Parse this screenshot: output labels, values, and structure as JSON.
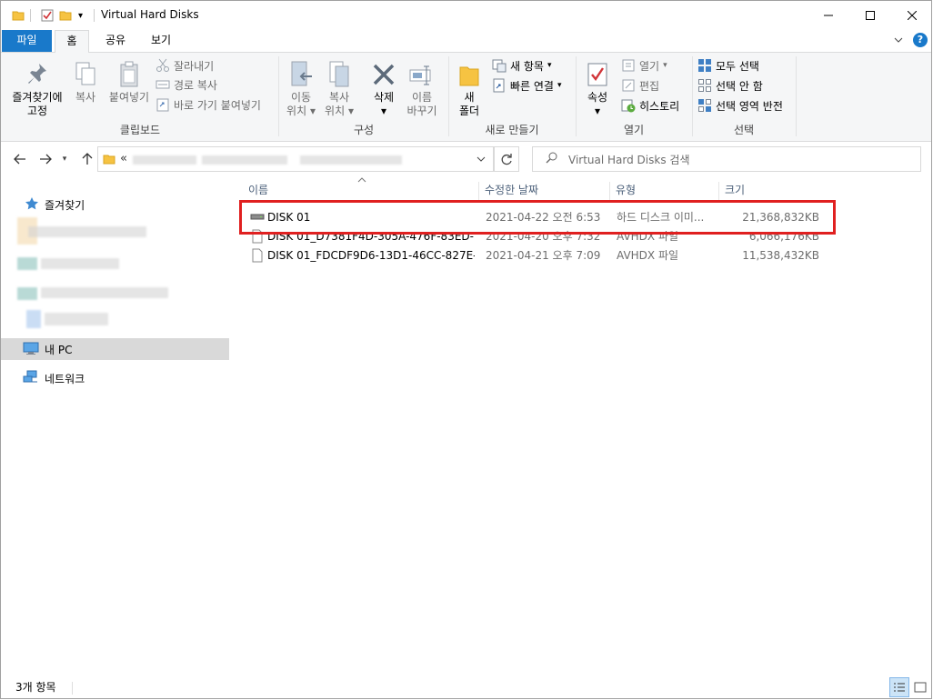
{
  "window": {
    "title": "Virtual Hard Disks"
  },
  "tabs": [
    "파일",
    "홈",
    "공유",
    "보기"
  ],
  "ribbon": {
    "clipboard": {
      "pin": "즐겨찾기에\n고정",
      "pin_l1": "즐겨찾기에",
      "pin_l2": "고정",
      "copy": "복사",
      "paste": "붙여넣기",
      "cut": "잘라내기",
      "copy_path": "경로 복사",
      "paste_shortcut": "바로 가기 붙여넣기",
      "label": "클립보드"
    },
    "organize": {
      "move_l1": "이동",
      "move_l2": "위치",
      "copyto_l1": "복사",
      "copyto_l2": "위치",
      "delete": "삭제",
      "rename_l1": "이름",
      "rename_l2": "바꾸기",
      "label": "구성"
    },
    "new": {
      "folder_l1": "새",
      "folder_l2": "폴더",
      "new_item": "새 항목",
      "easy_access": "빠른 연결",
      "label": "새로 만들기"
    },
    "open": {
      "properties": "속성",
      "open": "열기",
      "edit": "편집",
      "history": "히스토리",
      "label": "열기"
    },
    "select": {
      "select_all": "모두 선택",
      "select_none": "선택 안 함",
      "invert": "선택 영역 반전",
      "label": "선택"
    }
  },
  "address": {
    "prefix": "«"
  },
  "search": {
    "placeholder": "Virtual Hard Disks 검색"
  },
  "nav": {
    "favorites": "즐겨찾기",
    "this_pc": "내 PC",
    "network": "네트워크"
  },
  "columns": {
    "name": "이름",
    "modified": "수정한 날짜",
    "type": "유형",
    "size": "크기"
  },
  "files": [
    {
      "name": "DISK 01",
      "modified": "2021-04-22 오전 6:53",
      "type": "하드 디스크 이미...",
      "size": "21,368,832KB",
      "icon": "hard-disk-icon"
    },
    {
      "name": "DISK 01_D7381F4D-305A-476F-83ED-...",
      "modified": "2021-04-20 오후 7:32",
      "type": "AVHDX 파일",
      "size": "6,066,176KB",
      "icon": "file-icon"
    },
    {
      "name": "DISK 01_FDCDF9D6-13D1-46CC-827E-...",
      "modified": "2021-04-21 오후 7:09",
      "type": "AVHDX 파일",
      "size": "11,538,432KB",
      "icon": "file-icon"
    }
  ],
  "status": {
    "item_count": "3개 항목"
  },
  "colors": {
    "file_tab": "#1979ca",
    "highlight": "#e02020",
    "folder": "#f6c342"
  }
}
